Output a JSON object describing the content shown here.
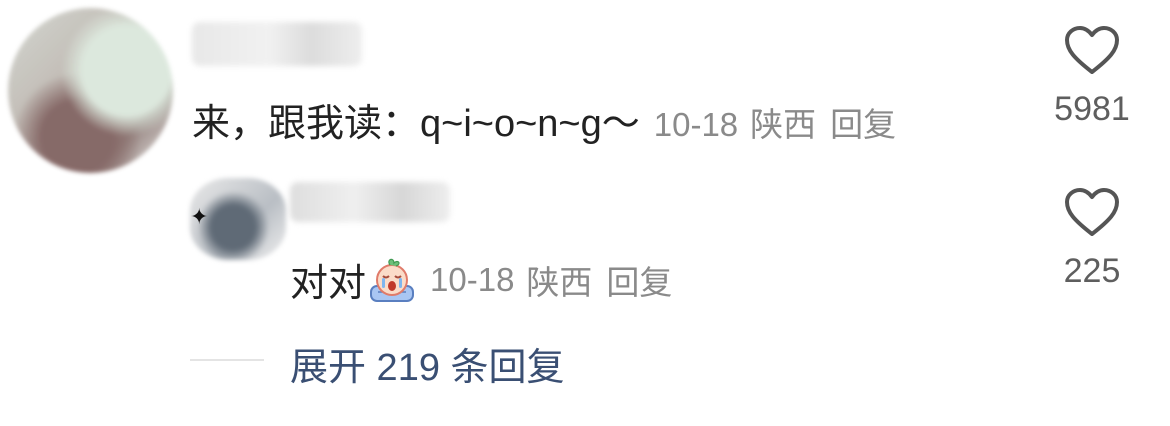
{
  "comment": {
    "text": "来，跟我读：q~i~o~n~g～",
    "date": "10-18",
    "location": "陕西",
    "reply_label": "回复",
    "like_count": "5981",
    "like_icon": "heart-outline-icon"
  },
  "reply": {
    "text": "对对",
    "emoji": "crying-emoji-icon",
    "date": "10-18",
    "location": "陕西",
    "reply_label": "回复",
    "like_count": "225",
    "like_icon": "heart-outline-icon"
  },
  "expand": {
    "label": "展开 219 条回复"
  },
  "colors": {
    "text": "#222222",
    "meta": "#8a8a8a",
    "link": "#3a4f73",
    "like": "#5e5e5e"
  }
}
